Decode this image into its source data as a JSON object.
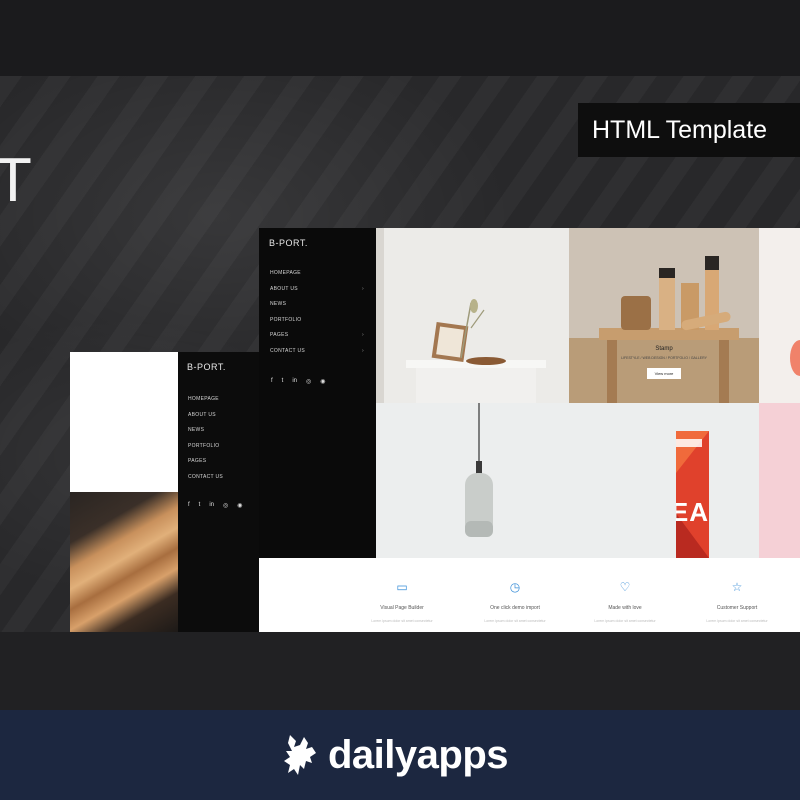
{
  "hero": {
    "title_fragment": "T"
  },
  "badge": {
    "text": "HTML Template"
  },
  "preview_front": {
    "logo": "B-PORT.",
    "menu": [
      {
        "label": "HOMEPAGE",
        "has_arrow": false
      },
      {
        "label": "ABOUT US",
        "has_arrow": true
      },
      {
        "label": "NEWS",
        "has_arrow": false
      },
      {
        "label": "PORTFOLIO",
        "has_arrow": false
      },
      {
        "label": "PAGES",
        "has_arrow": true
      },
      {
        "label": "CONTACT US",
        "has_arrow": true
      }
    ],
    "arrow_glyph": "›",
    "social": [
      "f",
      "t",
      "in",
      "◎",
      "◉"
    ],
    "hero_item": {
      "title": "Stamp",
      "caption": "LIFESTYLE / WEB DESIGN / PORTFOLIO / GALLERY",
      "button": "View more"
    },
    "tea_label": "TEA",
    "features": [
      {
        "icon": "monitor-icon",
        "glyph": "▭",
        "title": "Visual Page Builder",
        "text": "Lorem ipsum dolor sit amet consectetur"
      },
      {
        "icon": "watch-icon",
        "glyph": "◷",
        "title": "One click demo import",
        "text": "Lorem ipsum dolor sit amet consectetur"
      },
      {
        "icon": "heart-icon",
        "glyph": "♡",
        "title": "Made with love",
        "text": "Lorem ipsum dolor sit amet consectetur"
      },
      {
        "icon": "star-icon",
        "glyph": "☆",
        "title": "Customer Support",
        "text": "Lorem ipsum dolor sit amet consectetur"
      }
    ]
  },
  "preview_back": {
    "logo": "B-PORT.",
    "menu": [
      "HOMEPAGE",
      "ABOUT US",
      "NEWS",
      "PORTFOLIO",
      "PAGES",
      "CONTACT US"
    ],
    "social": [
      "f",
      "t",
      "in",
      "◎",
      "◉"
    ]
  },
  "footer": {
    "brand": "dailyapps"
  },
  "colors": {
    "background": "#232325",
    "footer": "#1c2740",
    "accent_icon": "#3b8fd8",
    "tea_red": "#e0412c"
  }
}
